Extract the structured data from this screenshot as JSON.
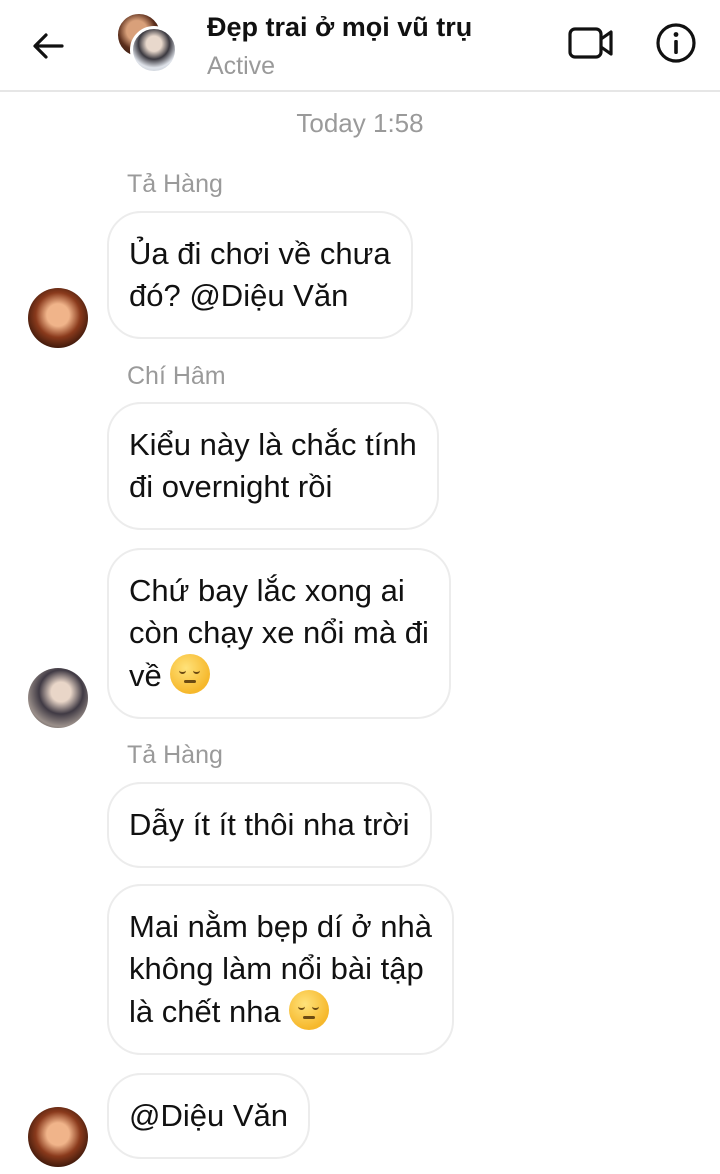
{
  "header": {
    "title": "Đẹp trai ở mọi vũ trụ",
    "status": "Active"
  },
  "timestamp": "Today 1:58",
  "messages": [
    {
      "sender": "Tả Hàng",
      "text": "Ủa đi chơi về chưa\nđó? @Diệu Văn",
      "emoji": false
    },
    {
      "sender": "Chí Hâm",
      "text": "Kiểu này là chắc tính\nđi overnight rồi",
      "emoji": false
    },
    {
      "sender": "",
      "text": "Chứ bay lắc xong ai\ncòn chạy xe nổi mà đi\nvề ",
      "emoji": true
    },
    {
      "sender": "Tả Hàng",
      "text": "Dẫy ít ít thôi nha trời",
      "emoji": false
    },
    {
      "sender": "",
      "text": "Mai nằm bẹp dí ở nhà\nkhông làm nổi bài tập\nlà chết nha ",
      "emoji": true
    },
    {
      "sender": "",
      "text": "@Diệu Văn",
      "emoji": false
    }
  ],
  "icons": {
    "back": "arrow-left-icon",
    "video": "video-camera-icon",
    "info": "info-circle-icon",
    "emoji": "pensive-face-emoji"
  }
}
